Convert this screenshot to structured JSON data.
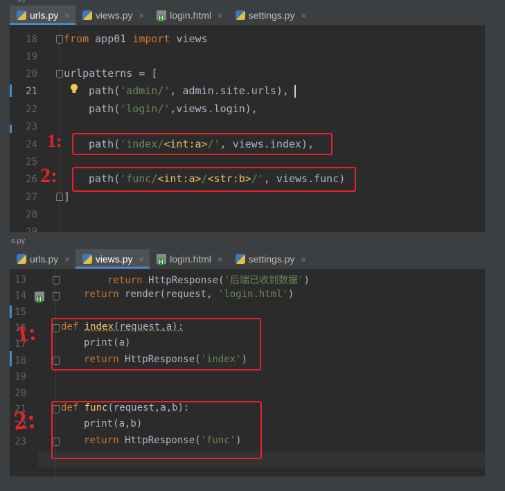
{
  "top_window": {
    "title_fragment": "py",
    "tabs": [
      {
        "label": "urls.py",
        "icon": "python-file-icon",
        "active": true
      },
      {
        "label": "views.py",
        "icon": "python-file-icon",
        "active": false
      },
      {
        "label": "login.html",
        "icon": "html-file-icon",
        "active": false
      },
      {
        "label": "settings.py",
        "icon": "python-file-icon",
        "active": false
      }
    ],
    "close_glyph": "×",
    "line_numbers": [
      "18",
      "19",
      "20",
      "21",
      "22",
      "23",
      "24",
      "25",
      "26",
      "27",
      "28",
      "29"
    ],
    "code": {
      "l18": {
        "from": "from",
        "mod": " app01 ",
        "import": "import",
        "rest": " views"
      },
      "l20": {
        "text": "urlpatterns = ["
      },
      "l21": {
        "a": "path(",
        "s": "'admin/'",
        "b": ", admin.site.urls),"
      },
      "l22": {
        "a": "path(",
        "s": "'login/'",
        "b": ",views.login),"
      },
      "l24": {
        "a": "path(",
        "s1": "'index/",
        "t": "<int:a>",
        "s2": "/'",
        "b": ", views.index),"
      },
      "l26": {
        "a": "path(",
        "s1": "'func/",
        "t1": "<int:a>",
        "s2": "/",
        "t2": "<str:b>",
        "s3": "/'",
        "b": ", views.func)"
      },
      "l27": {
        "text": "]"
      }
    },
    "annotations": [
      "1:",
      "2:"
    ]
  },
  "bottom_window": {
    "title_fragment": "s.py",
    "tabs": [
      {
        "label": "urls.py",
        "icon": "python-file-icon",
        "active": false
      },
      {
        "label": "views.py",
        "icon": "python-file-icon",
        "active": true
      },
      {
        "label": "login.html",
        "icon": "html-file-icon",
        "active": false
      },
      {
        "label": "settings.py",
        "icon": "python-file-icon",
        "active": false
      }
    ],
    "close_glyph": "×",
    "line_numbers": [
      "13",
      "14",
      "15",
      "16",
      "17",
      "18",
      "19",
      "20",
      "21",
      "22",
      "23"
    ],
    "code": {
      "l13": {
        "kw": "return",
        "rest": " HttpResponse(",
        "s": "'后端已收到数据'",
        "end": ")"
      },
      "l14": {
        "kw": "return",
        "rest": " render(request, ",
        "s": "'login.html'",
        "end": ")"
      },
      "l16": {
        "kw": "def",
        "name": "index",
        "rest": "(request,a):"
      },
      "l17": {
        "text": "print(a)"
      },
      "l18b": {
        "kw": "return",
        "rest": " HttpResponse(",
        "s": "'index'",
        "end": ")"
      },
      "l21": {
        "kw": "def",
        "name": "func",
        "rest": "(request,a,b):"
      },
      "l22": {
        "text": "print(a,b)"
      },
      "l23": {
        "kw": "return",
        "rest": " HttpResponse(",
        "s": "'func'",
        "end": ")"
      }
    },
    "annotations": [
      "1:",
      "2:"
    ]
  }
}
